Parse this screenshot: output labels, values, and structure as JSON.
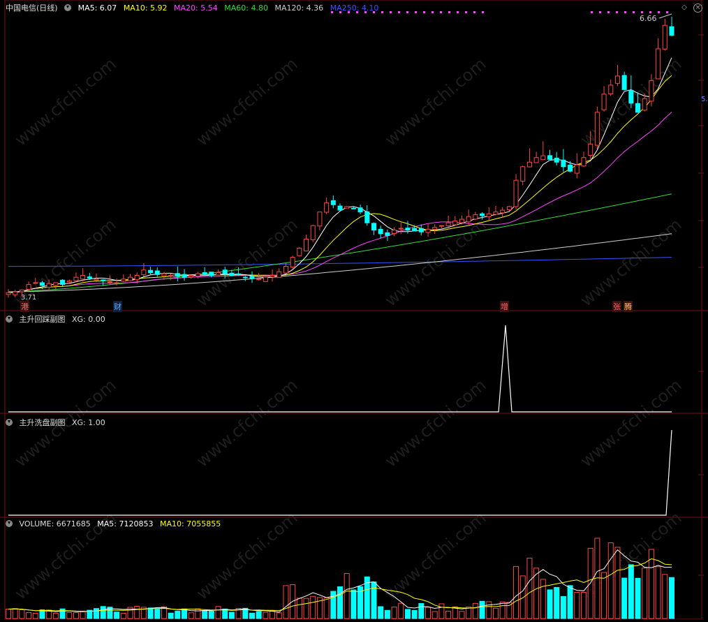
{
  "title": "中国电信(日线)",
  "colors": {
    "ma5": "#ffffff",
    "ma10": "#ffff00",
    "ma20": "#ff44ff",
    "ma60": "#33dd33",
    "ma120": "#cfcfcf",
    "ma250": "#3355ff",
    "up": "#ff4444",
    "down": "#00ffff",
    "grid": "#7a1010"
  },
  "ma_legend": [
    {
      "label": "MA5: 6.07",
      "color": "#ffffff"
    },
    {
      "label": "MA10: 5.92",
      "color": "#ffff00"
    },
    {
      "label": "MA20: 5.54",
      "color": "#ff44ff"
    },
    {
      "label": "MA60: 4.80",
      "color": "#33dd33"
    },
    {
      "label": "MA120: 4.36",
      "color": "#cfcfcf"
    },
    {
      "label": "MA250: 4.10",
      "color": "#3355ff"
    }
  ],
  "price_high_label": "6.66",
  "price_low_label": "3.71",
  "right_edge_label": "5.",
  "event_markers": [
    {
      "text": "港",
      "color": "#ff6666"
    },
    {
      "text": "财",
      "color": "#66aaff"
    },
    {
      "text": "增",
      "color": "#ff6666"
    },
    {
      "text": "张",
      "color": "#ff6666"
    },
    {
      "text": "腾",
      "color": "#ffcc44"
    }
  ],
  "panel2": {
    "name": "主升回踩副图",
    "value": "XG: 0.00"
  },
  "panel3": {
    "name": "主升洗盘副图",
    "value": "XG: 1.00"
  },
  "panel4": {
    "name": "VOLUME: 6671685",
    "ma5": "MA5: 7120853",
    "ma10": "MA10: 7055855"
  },
  "watermark": "www.cfchi.com",
  "chart_data": [
    {
      "type": "candlestick",
      "title": "中国电信(日线)",
      "series_closes_approx": [
        3.71,
        3.72,
        3.74,
        3.8,
        3.82,
        3.79,
        3.81,
        3.82,
        3.8,
        3.84,
        3.88,
        3.9,
        3.87,
        3.86,
        3.84,
        3.83,
        3.82,
        3.86,
        3.88,
        3.9,
        3.96,
        3.93,
        3.91,
        3.92,
        3.9,
        3.89,
        3.88,
        3.9,
        3.92,
        3.91,
        3.9,
        3.93,
        3.92,
        3.9,
        3.91,
        3.88,
        3.87,
        3.86,
        3.88,
        3.9,
        3.94,
        4.0,
        4.1,
        4.2,
        4.3,
        4.45,
        4.6,
        4.7,
        4.68,
        4.62,
        4.66,
        4.64,
        4.6,
        4.48,
        4.4,
        4.36,
        4.34,
        4.4,
        4.42,
        4.4,
        4.39,
        4.38,
        4.41,
        4.43,
        4.45,
        4.48,
        4.5,
        4.52,
        4.55,
        4.57,
        4.56,
        4.58,
        4.6,
        4.62,
        4.66,
        4.95,
        5.1,
        5.15,
        5.2,
        5.22,
        5.18,
        5.15,
        5.1,
        5.05,
        5.12,
        5.2,
        5.35,
        5.7,
        5.9,
        6.0,
        6.1,
        5.95,
        5.8,
        5.7,
        5.85,
        6.05,
        6.4,
        6.66,
        6.55
      ],
      "high": 6.66,
      "low": 3.71,
      "ma_last": {
        "MA5": 6.07,
        "MA10": 5.92,
        "MA20": 5.54,
        "MA60": 4.8,
        "MA120": 4.36,
        "MA250": 4.1
      }
    },
    {
      "type": "line",
      "title": "主升回踩副图",
      "series": [
        {
          "name": "XG",
          "spike_index": 83,
          "last": 0.0
        }
      ]
    },
    {
      "type": "line",
      "title": "主升洗盘副图",
      "series": [
        {
          "name": "XG",
          "last": 1.0
        }
      ]
    },
    {
      "type": "bar",
      "title": "VOLUME",
      "series": [
        {
          "name": "VOLUME",
          "last": 6671685
        },
        {
          "name": "MA5",
          "last": 7120853
        },
        {
          "name": "MA10",
          "last": 7055855
        }
      ]
    }
  ]
}
